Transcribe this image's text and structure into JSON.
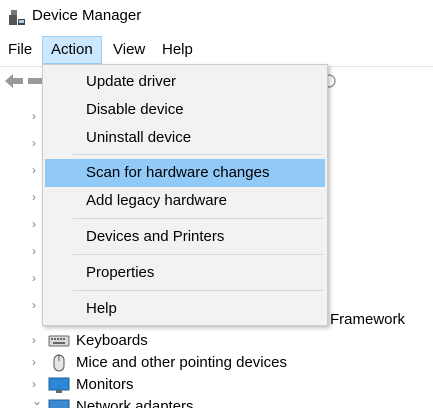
{
  "window": {
    "title": "Device Manager",
    "app_icon": "device-manager-icon"
  },
  "menubar": {
    "items": [
      "File",
      "Action",
      "View",
      "Help"
    ],
    "active": "Action"
  },
  "action_menu": {
    "items": [
      "Update driver",
      "Disable device",
      "Uninstall device",
      "Scan for hardware changes",
      "Add legacy hardware",
      "Devices and Printers",
      "Properties",
      "Help"
    ],
    "highlighted": "Scan for hardware changes"
  },
  "tree": {
    "partial_label": "Framework",
    "rows": [
      {
        "label": "Keyboards",
        "icon": "keyboard-icon"
      },
      {
        "label": "Mice and other pointing devices",
        "icon": "mouse-icon"
      },
      {
        "label": "Monitors",
        "icon": "monitor-icon"
      },
      {
        "label": "Network adapters",
        "icon": "network-adapter-icon"
      }
    ]
  },
  "colors": {
    "menu_highlight": "#91c9f7",
    "menubar_active": "#cce8ff"
  }
}
